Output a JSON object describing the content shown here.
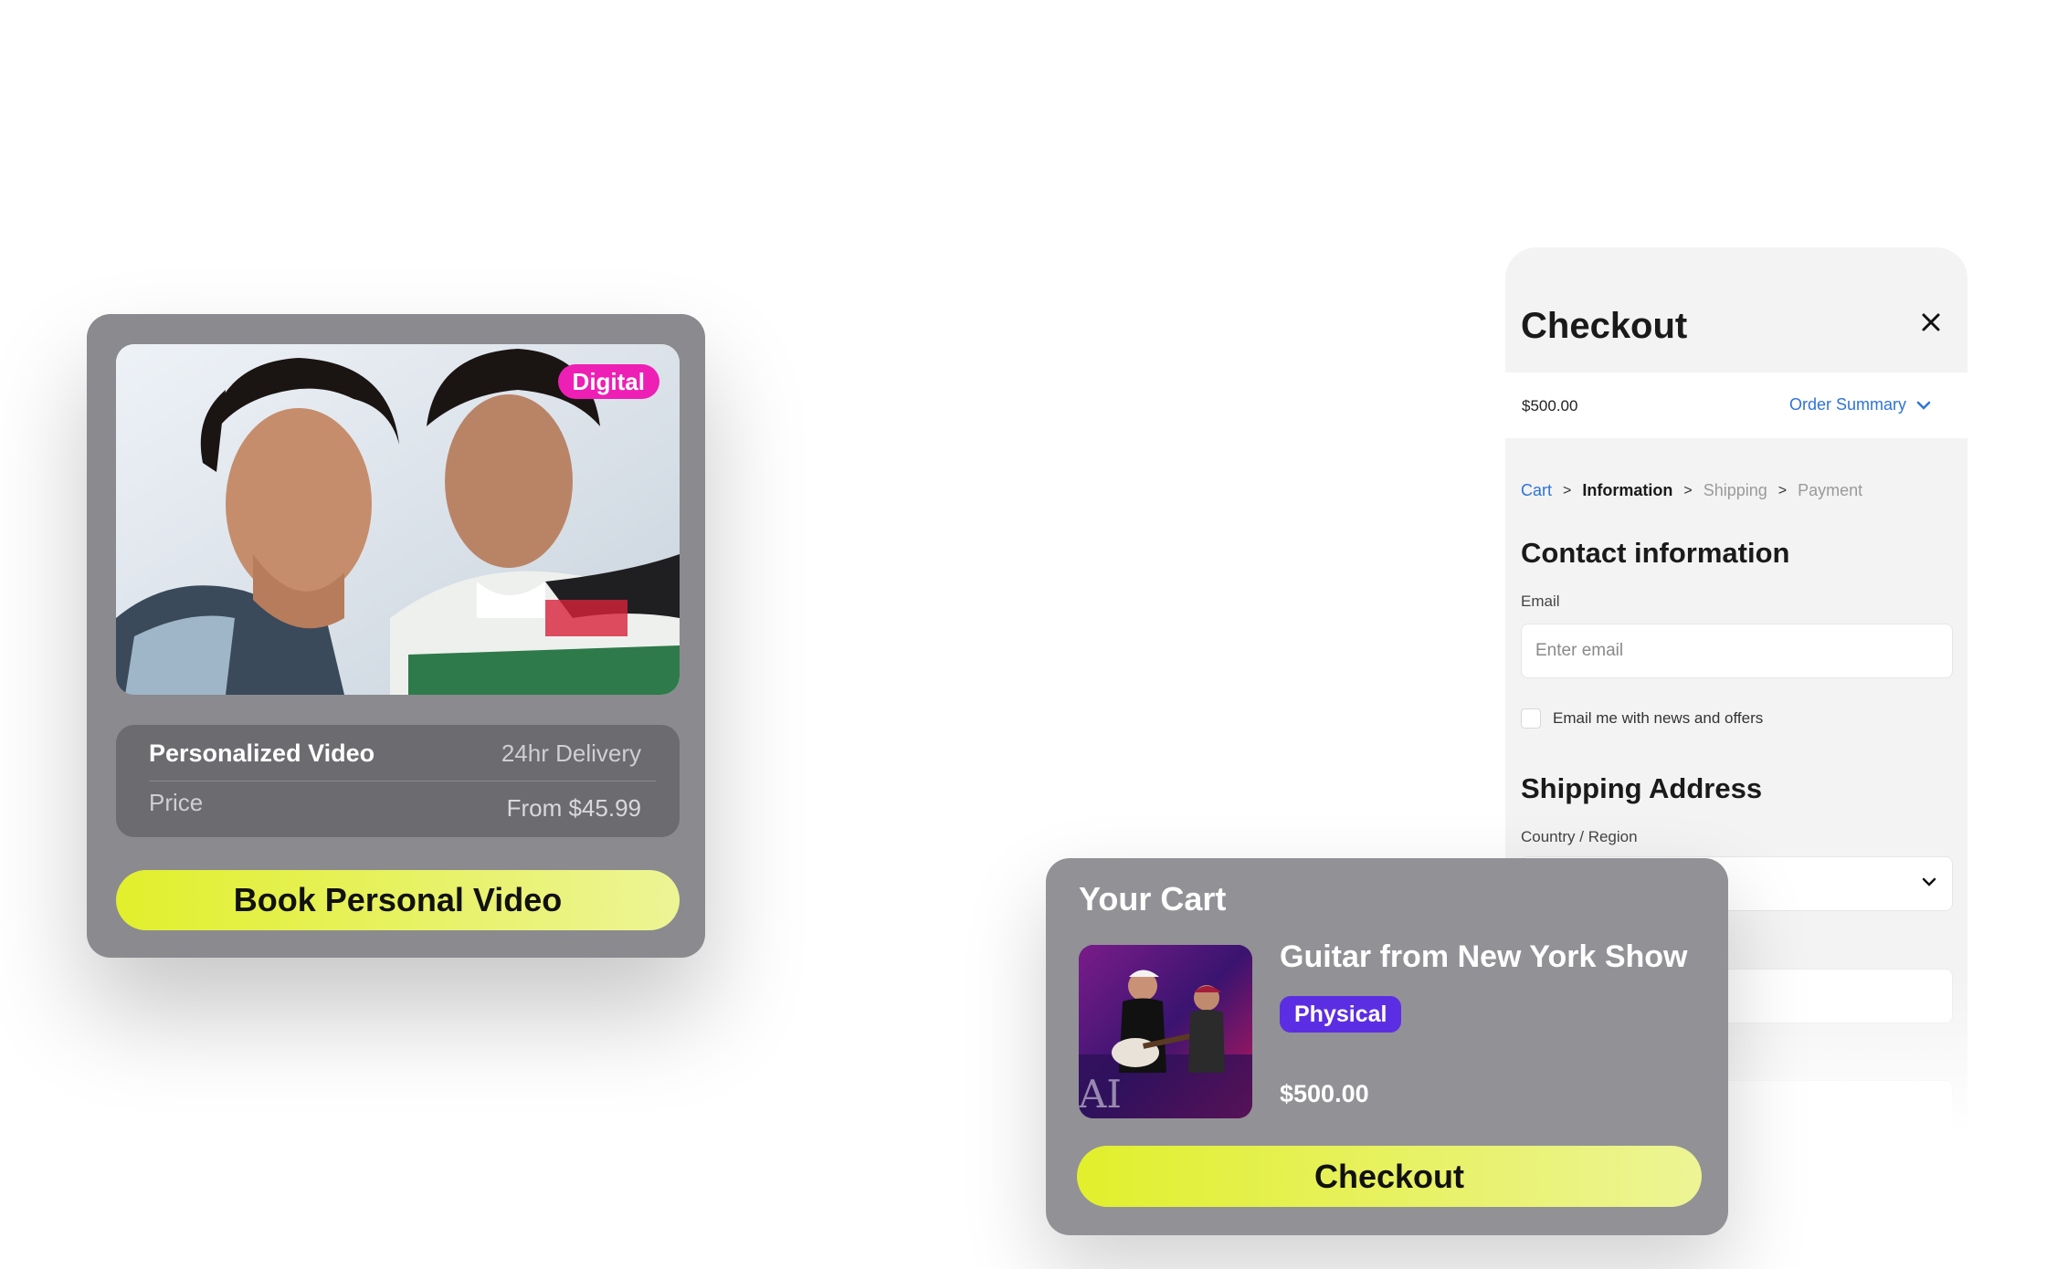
{
  "product_card": {
    "badge": "Digital",
    "product_name": "Personalized Video",
    "delivery": "24hr Delivery",
    "price_label": "Price",
    "price_value": "From $45.99",
    "cta_label": "Book Personal Video",
    "badge_color": "#ee1fb4",
    "cta_color": "#e1ef2c"
  },
  "checkout_panel": {
    "title": "Checkout",
    "total": "$500.00",
    "order_summary_label": "Order Summary",
    "breadcrumb": [
      "Cart",
      "Information",
      "Shipping",
      "Payment"
    ],
    "contact_heading": "Contact information",
    "email_label": "Email",
    "email_placeholder": "Enter email",
    "newsletter_label": "Email me with news and offers",
    "shipping_heading": "Shipping Address",
    "country_label": "Country / Region",
    "link_color": "#2e73d9"
  },
  "cart": {
    "title": "Your Cart",
    "item_name": "Guitar from New York Show",
    "item_badge": "Physical",
    "item_price": "$500.00",
    "checkout_label": "Checkout",
    "badge_color": "#5c2ee3"
  }
}
